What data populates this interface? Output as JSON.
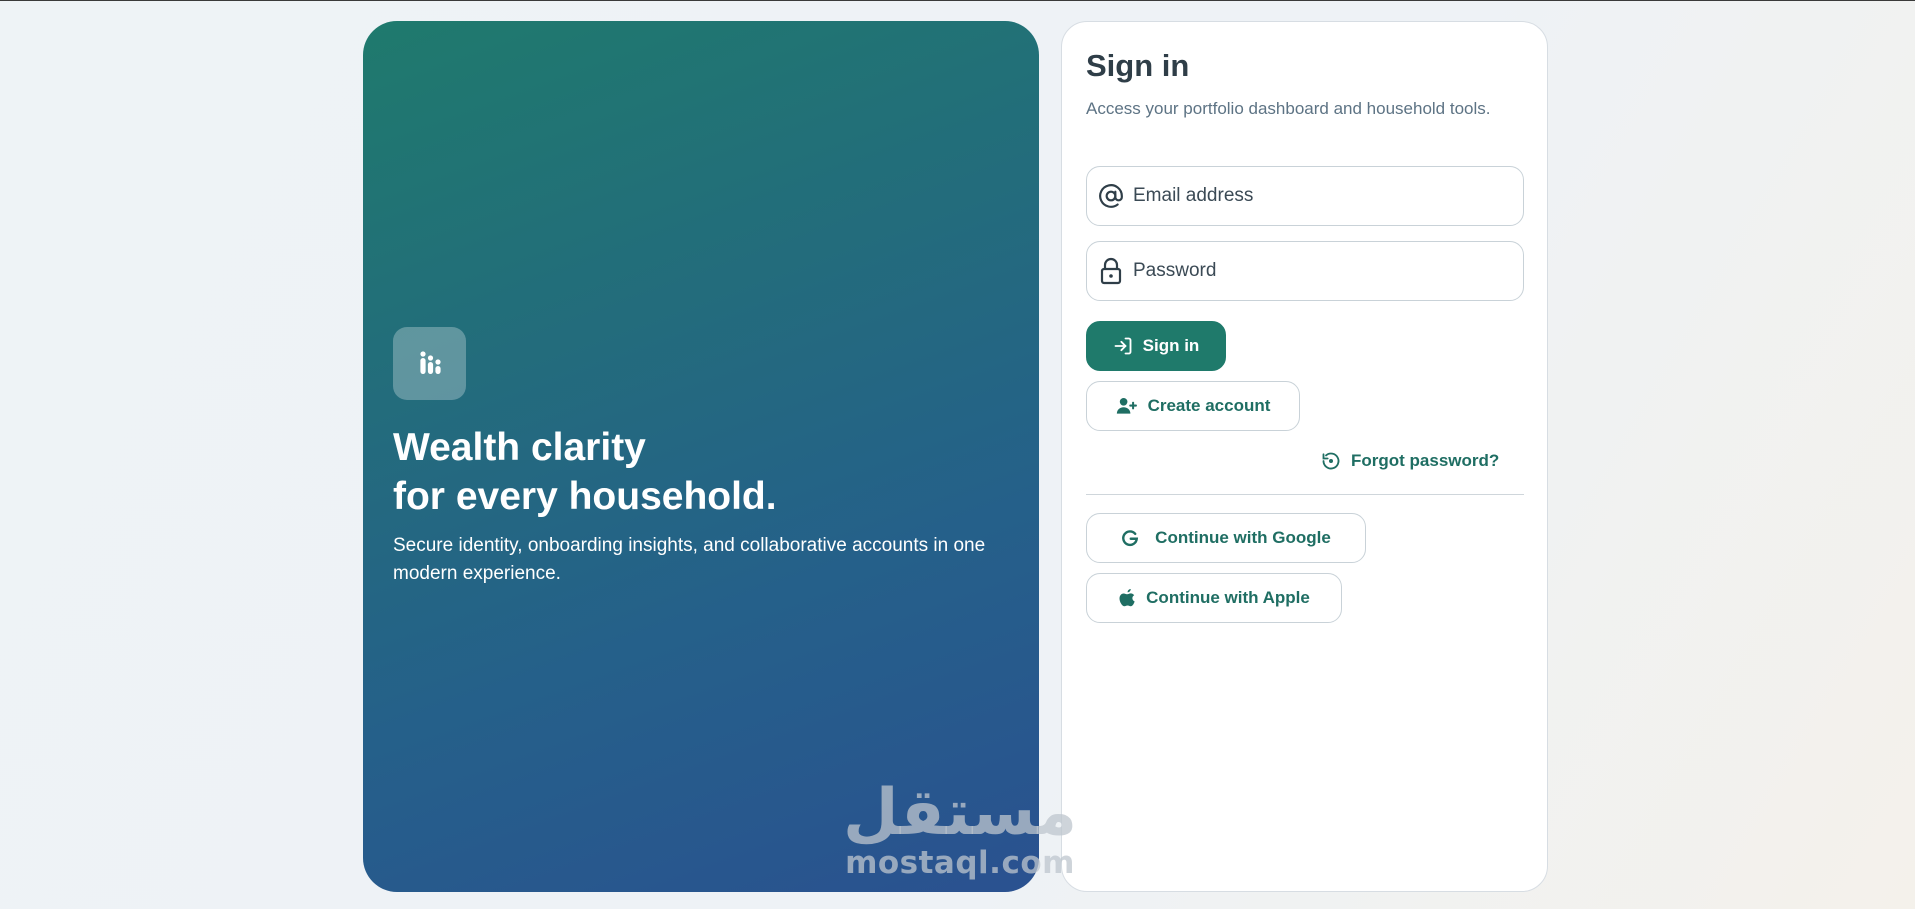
{
  "hero": {
    "logo_icon": "bar-chart-icon",
    "title_line1": "Wealth clarity",
    "title_line2": "for every household.",
    "subtitle": "Secure identity, onboarding insights, and collaborative accounts in one modern experience."
  },
  "signin": {
    "title": "Sign in",
    "subtitle": "Access your portfolio dashboard and household tools.",
    "email_placeholder": "Email address",
    "password_placeholder": "Password",
    "signin_label": "Sign in",
    "create_account_label": "Create account",
    "forgot_label": "Forgot password?",
    "google_label": "Continue with Google",
    "apple_label": "Continue with Apple"
  },
  "watermark": {
    "arabic": "مستقل",
    "latin": "mostaql.com"
  },
  "colors": {
    "accent": "#1f7a6b",
    "hero_start": "#1f7a6d",
    "hero_end": "#2a5190"
  }
}
